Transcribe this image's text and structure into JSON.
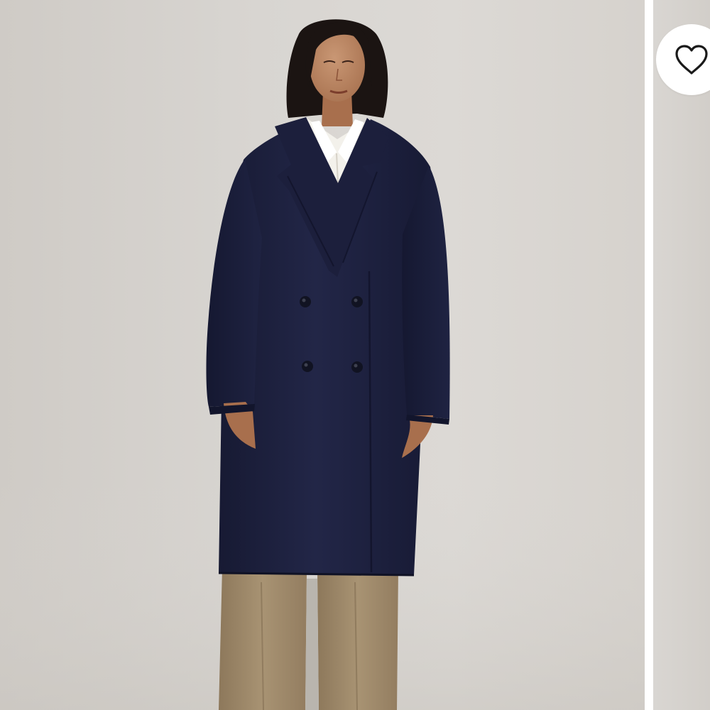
{
  "product_gallery": {
    "current_slide": 1,
    "slides": [
      {
        "image": "woman-in-navy-double-breasted-wool-coat",
        "background_color": "#d8d5d1",
        "coat_color": "#1e2140",
        "shirt_color": "#f4f2ec",
        "trousers_color": "#a58f70"
      },
      {
        "image": "next-product-image-partially-visible",
        "background_color": "#d4d0cb"
      }
    ]
  },
  "wishlist": {
    "icon": "heart-outline-icon",
    "button_color": "#ffffff",
    "icon_color": "#1a1a1a",
    "saved": false
  }
}
